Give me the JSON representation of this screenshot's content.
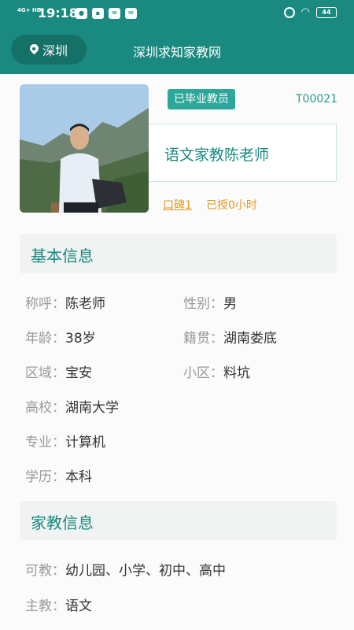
{
  "status_bar": {
    "network": "4G+ HD",
    "time": "19:18",
    "app_icons": [
      "chat-icon",
      "app-icon",
      "mail-icon",
      "mail-icon"
    ],
    "battery": "44"
  },
  "header": {
    "city": "深圳",
    "title": "深圳求知家教网"
  },
  "profile": {
    "status_tag": "已毕业教员",
    "teacher_id": "T00021",
    "name": "语文家教陈老师",
    "reputation": "口碑1",
    "hours": "已授0小时"
  },
  "basic_info": {
    "title": "基本信息",
    "fields": [
      {
        "label": "称呼：",
        "value": "陈老师"
      },
      {
        "label": "性别：",
        "value": "男"
      },
      {
        "label": "年龄：",
        "value": "38岁"
      },
      {
        "label": "籍贯：",
        "value": "湖南娄底"
      },
      {
        "label": "区域：",
        "value": "宝安"
      },
      {
        "label": "小区：",
        "value": "料坑"
      },
      {
        "label": "高校：",
        "value": "湖南大学"
      },
      {
        "label": "专业：",
        "value": "计算机"
      },
      {
        "label": "学历：",
        "value": "本科"
      }
    ]
  },
  "tutoring_info": {
    "title": "家教信息",
    "fields": [
      {
        "label": "可教：",
        "value": "幼儿园、小学、初中、高中"
      },
      {
        "label": "主教：",
        "value": "语文"
      }
    ]
  }
}
